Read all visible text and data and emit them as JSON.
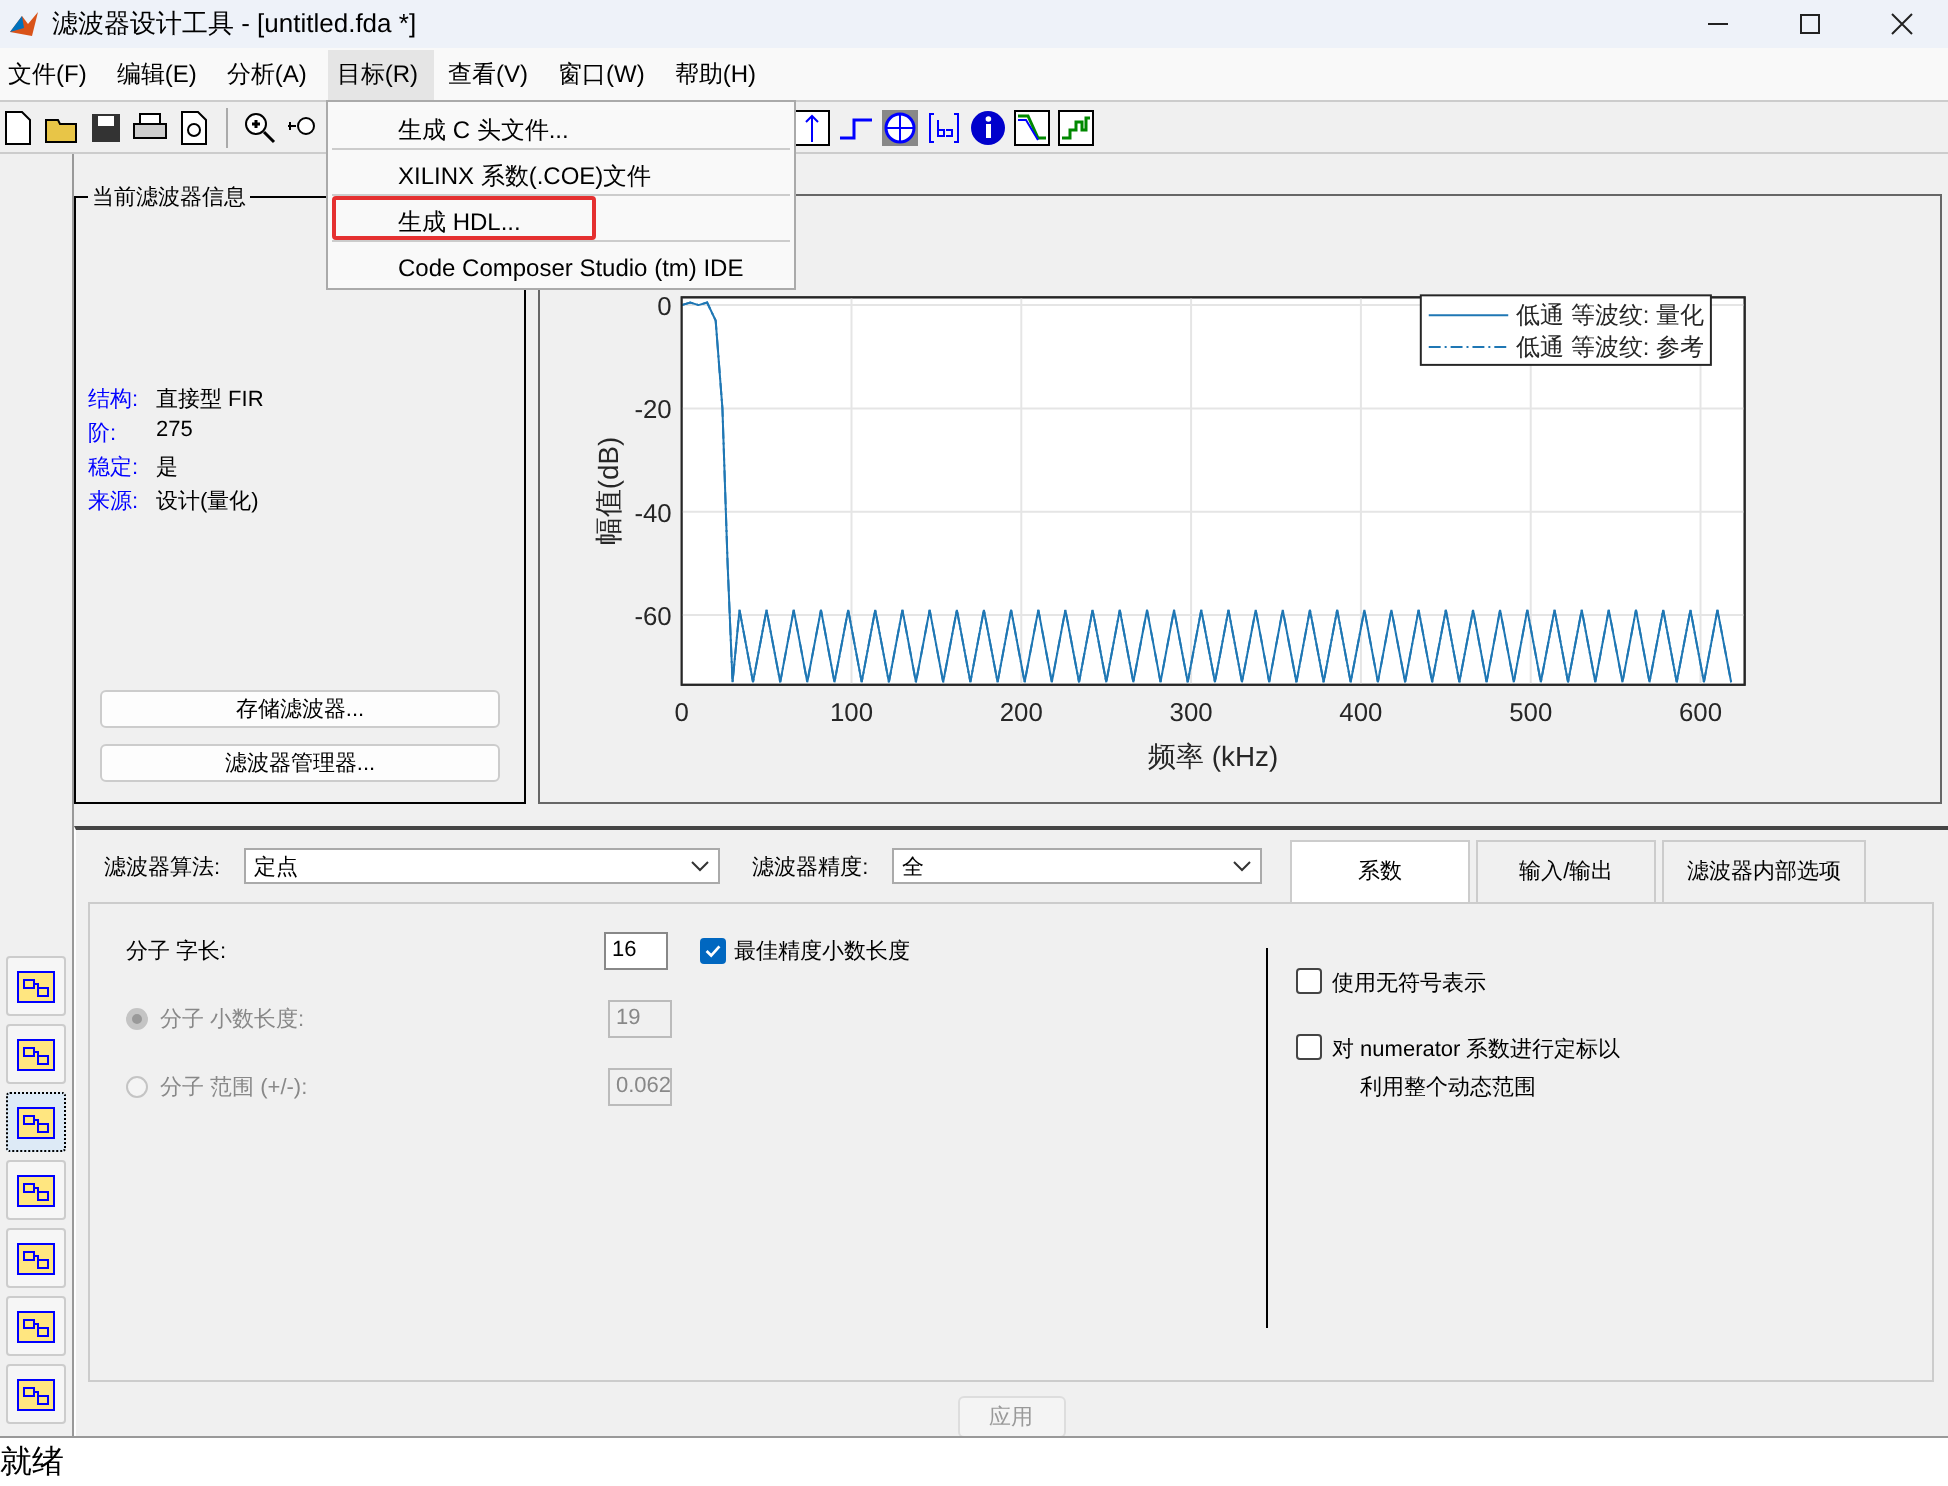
{
  "window": {
    "title": "滤波器设计工具 - [untitled.fda *]"
  },
  "menu_bar": [
    {
      "label": "文件(F)",
      "selected": false
    },
    {
      "label": "编辑(E)",
      "selected": false
    },
    {
      "label": "分析(A)",
      "selected": false
    },
    {
      "label": "目标(R)",
      "selected": true
    },
    {
      "label": "查看(V)",
      "selected": false
    },
    {
      "label": "窗口(W)",
      "selected": false
    },
    {
      "label": "帮助(H)",
      "selected": false
    }
  ],
  "dropdown": [
    {
      "label": "生成 C 头文件...",
      "highlighted": false
    },
    {
      "label": "XILINX 系数(.COE)文件",
      "highlighted": false
    },
    {
      "label": "生成 HDL...",
      "highlighted": true
    },
    {
      "label": "Code Composer Studio (tm) IDE",
      "highlighted": false
    }
  ],
  "side_tools": [
    {
      "selected": false
    },
    {
      "selected": false
    },
    {
      "selected": true
    },
    {
      "selected": false
    },
    {
      "selected": false
    },
    {
      "selected": false
    },
    {
      "selected": false
    }
  ],
  "filter_info": {
    "title": "当前滤波器信息",
    "rows": [
      {
        "label": "结构:",
        "value": "直接型 FIR"
      },
      {
        "label": "阶:",
        "value": "275"
      },
      {
        "label": "稳定:",
        "value": "是"
      },
      {
        "label": "来源:",
        "value": "设计(量化)"
      }
    ],
    "buttons": [
      "存储滤波器...",
      "滤波器管理器..."
    ]
  },
  "plot": {
    "chart_data": {
      "type": "line",
      "xlabel": "频率 (kHz)",
      "ylabel": "幅值(dB)",
      "xlim": [
        0,
        626
      ],
      "ylim": [
        -73.5,
        1.5
      ],
      "xticks": [
        0,
        100,
        200,
        300,
        400,
        500,
        600
      ],
      "yticks": [
        0,
        -20,
        -40,
        -60
      ],
      "grid": true,
      "legend": "upper right",
      "x": [
        0,
        5,
        10,
        15,
        20,
        24,
        27,
        30,
        34,
        42,
        50,
        58,
        66,
        74,
        82,
        90,
        98,
        106,
        114,
        122,
        130,
        138,
        146,
        154,
        162,
        170,
        178,
        186,
        194,
        202,
        210,
        218,
        226,
        234,
        242,
        250,
        258,
        266,
        274,
        282,
        290,
        298,
        306,
        314,
        322,
        330,
        338,
        346,
        354,
        362,
        370,
        378,
        386,
        394,
        402,
        410,
        418,
        426,
        434,
        442,
        450,
        458,
        466,
        474,
        482,
        490,
        498,
        506,
        514,
        522,
        530,
        538,
        546,
        554,
        562,
        570,
        578,
        586,
        594,
        602,
        610,
        618
      ],
      "series": [
        {
          "name": "低通 等波纹: 量化",
          "color": "#1f77b4",
          "line_style": "solid",
          "values": [
            0,
            0.5,
            0,
            0.5,
            -3,
            -20,
            -50,
            -73,
            -59,
            -73,
            -59,
            -73,
            -59,
            -73,
            -59,
            -73,
            -59,
            -73,
            -59,
            -73,
            -59,
            -73,
            -59,
            -73,
            -59,
            -73,
            -59,
            -73,
            -59,
            -73,
            -59,
            -73,
            -59,
            -73,
            -59,
            -73,
            -59,
            -73,
            -59,
            -73,
            -59,
            -73,
            -59,
            -73,
            -59,
            -73,
            -59,
            -73,
            -59,
            -73,
            -59,
            -73,
            -59,
            -73,
            -59,
            -73,
            -59,
            -73,
            -59,
            -73,
            -59,
            -73,
            -59,
            -73,
            -59,
            -73,
            -59,
            -73,
            -59,
            -73,
            -59,
            -73,
            -59,
            -73,
            -59,
            -73,
            -59,
            -73,
            -59,
            -73,
            -59,
            -73
          ]
        },
        {
          "name": "低通 等波纹: 参考",
          "color": "#1f77b4",
          "line_style": "dashdot",
          "values": [
            0,
            0.5,
            0,
            0.5,
            -3,
            -20,
            -50,
            -73,
            -59,
            -73,
            -59,
            -73,
            -59,
            -73,
            -59,
            -73,
            -59,
            -73,
            -59,
            -73,
            -59,
            -73,
            -59,
            -73,
            -59,
            -73,
            -59,
            -73,
            -59,
            -73,
            -59,
            -73,
            -59,
            -73,
            -59,
            -73,
            -59,
            -73,
            -59,
            -73,
            -59,
            -73,
            -59,
            -73,
            -59,
            -73,
            -59,
            -73,
            -59,
            -73,
            -59,
            -73,
            -59,
            -73,
            -59,
            -73,
            -59,
            -73,
            -59,
            -73,
            -59,
            -73,
            -59,
            -73,
            -59,
            -73,
            -59,
            -73,
            -59,
            -73,
            -59,
            -73,
            -59,
            -73,
            -59,
            -73,
            -59,
            -73,
            -59,
            -73,
            -59,
            -73
          ]
        }
      ]
    }
  },
  "settings": {
    "algorithm_label": "滤波器算法:",
    "algorithm": "定点",
    "precision_label": "滤波器精度:",
    "precision": "全",
    "tabs": [
      {
        "label": "系数",
        "selected": true
      },
      {
        "label": "输入/输出",
        "selected": false
      },
      {
        "label": "滤波器内部选项",
        "selected": false
      }
    ],
    "word_length_label": "分子 字长:",
    "word_length": "16",
    "best_precision": {
      "label": "最佳精度小数长度",
      "checked": true
    },
    "radios": [
      {
        "label": "分子 小数长度:",
        "value": "19",
        "selected": true,
        "disabled": true
      },
      {
        "label": "分子 范围 (+/-):",
        "value": "0.062",
        "selected": false,
        "disabled": true
      }
    ],
    "options": [
      {
        "label": "使用无符号表示",
        "checked": false
      },
      {
        "label": "对 numerator 系数进行定标以",
        "note": "利用整个动态范围",
        "checked": false
      }
    ],
    "apply": {
      "label": "应用",
      "disabled": true
    }
  },
  "status_bar": "就绪"
}
